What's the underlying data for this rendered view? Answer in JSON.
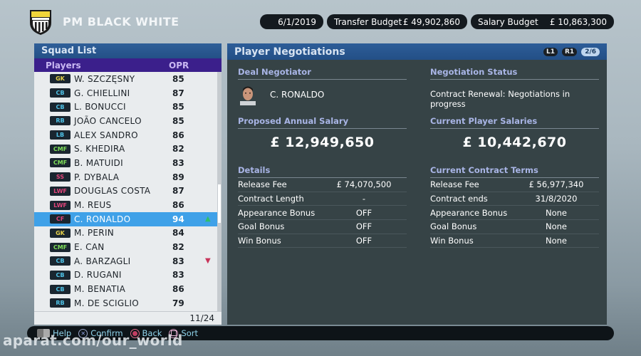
{
  "team": {
    "name": "PM BLACK WHITE"
  },
  "topbar": {
    "date": "6/1/2019",
    "transfer_budget_label": "Transfer Budget",
    "transfer_budget_value": "£ 49,902,860",
    "salary_budget_label": "Salary Budget",
    "salary_budget_value": "£ 10,863,300"
  },
  "squad": {
    "title": "Squad List",
    "col_players": "Players",
    "col_opr": "OPR",
    "footer": "11/24",
    "rows": [
      {
        "pos": "GK",
        "pos_color": "#e6d14a",
        "name": "W. SZCZĘSNY",
        "opr": "85"
      },
      {
        "pos": "CB",
        "pos_color": "#4fc3e8",
        "name": "G. CHIELLINI",
        "opr": "87"
      },
      {
        "pos": "CB",
        "pos_color": "#4fc3e8",
        "name": "L. BONUCCI",
        "opr": "85"
      },
      {
        "pos": "RB",
        "pos_color": "#4fc3e8",
        "name": "JOÃO CANCELO",
        "opr": "85"
      },
      {
        "pos": "LB",
        "pos_color": "#4fc3e8",
        "name": "ALEX SANDRO",
        "opr": "86"
      },
      {
        "pos": "CMF",
        "pos_color": "#7fe05a",
        "name": "S. KHEDIRA",
        "opr": "82"
      },
      {
        "pos": "CMF",
        "pos_color": "#7fe05a",
        "name": "B. MATUIDI",
        "opr": "83"
      },
      {
        "pos": "SS",
        "pos_color": "#e0457a",
        "name": "P. DYBALA",
        "opr": "89"
      },
      {
        "pos": "LWF",
        "pos_color": "#e0457a",
        "name": "DOUGLAS COSTA",
        "opr": "87"
      },
      {
        "pos": "LWF",
        "pos_color": "#e0457a",
        "name": "M. REUS",
        "opr": "86"
      },
      {
        "pos": "CF",
        "pos_color": "#e0457a",
        "name": "C. RONALDO",
        "opr": "94",
        "selected": true,
        "indicator": "up"
      },
      {
        "pos": "GK",
        "pos_color": "#e6d14a",
        "name": "M. PERIN",
        "opr": "84"
      },
      {
        "pos": "CMF",
        "pos_color": "#7fe05a",
        "name": "E. CAN",
        "opr": "82"
      },
      {
        "pos": "CB",
        "pos_color": "#4fc3e8",
        "name": "A. BARZAGLI",
        "opr": "83",
        "indicator": "down"
      },
      {
        "pos": "CB",
        "pos_color": "#4fc3e8",
        "name": "D. RUGANI",
        "opr": "83"
      },
      {
        "pos": "CB",
        "pos_color": "#4fc3e8",
        "name": "M. BENATIA",
        "opr": "86"
      },
      {
        "pos": "RB",
        "pos_color": "#4fc3e8",
        "name": "M. DE SCIGLIO",
        "opr": "79"
      }
    ]
  },
  "negotiations": {
    "title": "Player Negotiations",
    "l1": "L1",
    "r1": "R1",
    "page": "2/6",
    "deal_negotiator_label": "Deal Negotiator",
    "negotiator_name": "C. RONALDO",
    "status_label": "Negotiation Status",
    "status_text": "Contract Renewal: Negotiations in progress",
    "proposed_salary_label": "Proposed Annual Salary",
    "proposed_salary": "£  12,949,650",
    "current_salaries_label": "Current Player Salaries",
    "current_salaries": "£  10,442,670",
    "details": {
      "label": "Details",
      "rows": [
        {
          "k": "Release Fee",
          "v": "£  74,070,500"
        },
        {
          "k": "Contract Length",
          "v": "-"
        },
        {
          "k": "Appearance Bonus",
          "v": "OFF"
        },
        {
          "k": "Goal Bonus",
          "v": "OFF"
        },
        {
          "k": "Win Bonus",
          "v": "OFF"
        }
      ]
    },
    "current_terms": {
      "label": "Current Contract Terms",
      "rows": [
        {
          "k": "Release Fee",
          "v": "£  56,977,340"
        },
        {
          "k": "Contract ends",
          "v": "31/8/2020"
        },
        {
          "k": "Appearance Bonus",
          "v": "None"
        },
        {
          "k": "Goal Bonus",
          "v": "None"
        },
        {
          "k": "Win Bonus",
          "v": "None"
        }
      ]
    }
  },
  "bottom": {
    "help": "Help",
    "confirm": "Confirm",
    "back": "Back",
    "sort": "Sort"
  },
  "watermark": "aparat.com/our_world",
  "colors": {
    "indicator_up": "#2fbf6a",
    "indicator_down": "#c8345a",
    "selected_row": "#3fa1e8"
  }
}
